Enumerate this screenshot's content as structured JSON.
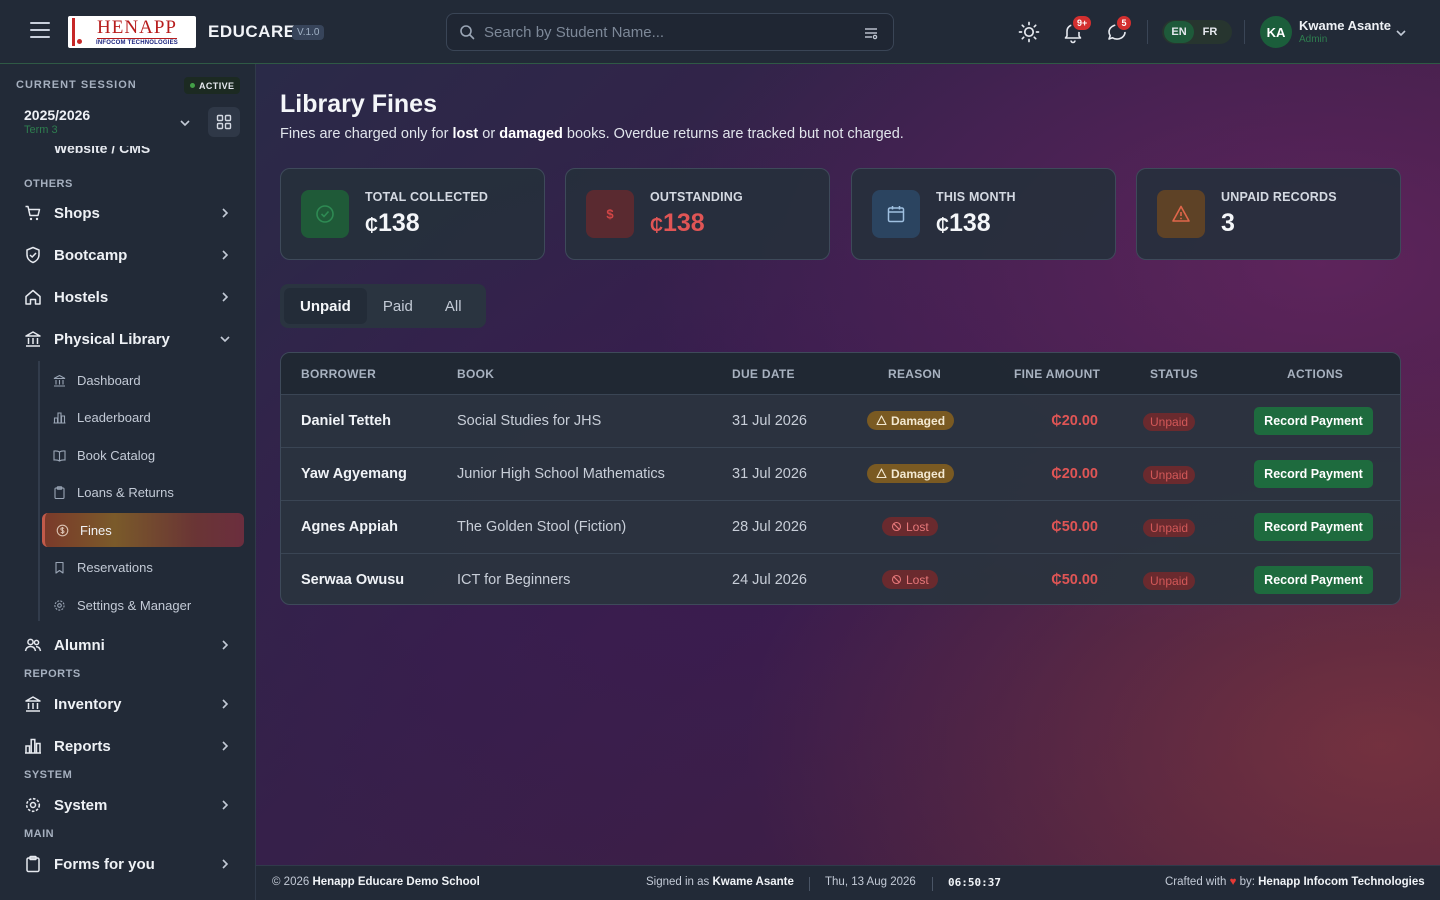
{
  "header": {
    "logo_big": "HENAPP",
    "logo_small": "INFOCOM TECHNOLOGIES",
    "brand": "EDUCARE",
    "version": "V.1.0",
    "search_placeholder": "Search by Student Name...",
    "notifications_badge": "9+",
    "messages_badge": "5",
    "lang_en": "EN",
    "lang_fr": "FR",
    "user_initials": "KA",
    "user_name": "Kwame Asante",
    "user_role": "Admin"
  },
  "sidebar": {
    "session_label": "CURRENT SESSION",
    "session_status": "ACTIVE",
    "session_year": "2025/2026",
    "session_term": "Term 3",
    "partial_item": "Website / CMS",
    "sections": {
      "others": "OTHERS",
      "reports": "REPORTS",
      "system": "SYSTEM",
      "main": "MAIN"
    },
    "items": {
      "shops": "Shops",
      "bootcamp": "Bootcamp",
      "hostels": "Hostels",
      "physical_library": "Physical Library",
      "alumni": "Alumni",
      "inventory": "Inventory",
      "reports": "Reports",
      "system": "System",
      "forms": "Forms for you"
    },
    "library_sub": {
      "dashboard": "Dashboard",
      "leaderboard": "Leaderboard",
      "catalog": "Book Catalog",
      "loans": "Loans & Returns",
      "fines": "Fines",
      "reservations": "Reservations",
      "settings": "Settings & Manager"
    }
  },
  "main": {
    "title": "Library Fines",
    "subtitle_pre": "Fines are charged only for ",
    "subtitle_b1": "lost",
    "subtitle_mid": " or ",
    "subtitle_b2": "damaged",
    "subtitle_post": " books. Overdue returns are tracked but not charged.",
    "cards": [
      {
        "label": "TOTAL COLLECTED",
        "currency": "₵",
        "value": "138"
      },
      {
        "label": "OUTSTANDING",
        "currency": "₵",
        "value": "138"
      },
      {
        "label": "THIS MONTH",
        "currency": "₵",
        "value": "138"
      },
      {
        "label": "UNPAID RECORDS",
        "value": "3"
      }
    ],
    "tabs": [
      "Unpaid",
      "Paid",
      "All"
    ],
    "table": {
      "headers": [
        "BORROWER",
        "BOOK",
        "DUE DATE",
        "REASON",
        "FINE AMOUNT",
        "STATUS",
        "ACTIONS"
      ],
      "rows": [
        {
          "borrower": "Daniel Tetteh",
          "book": "Social Studies for JHS",
          "due": "31 Jul 2026",
          "reason": "Damaged",
          "amount": "₵20.00",
          "status": "Unpaid",
          "action": "Record Payment"
        },
        {
          "borrower": "Yaw Agyemang",
          "book": "Junior High School Mathematics",
          "due": "31 Jul 2026",
          "reason": "Damaged",
          "amount": "₵20.00",
          "status": "Unpaid",
          "action": "Record Payment"
        },
        {
          "borrower": "Agnes Appiah",
          "book": "The Golden Stool (Fiction)",
          "due": "28 Jul 2026",
          "reason": "Lost",
          "amount": "₵50.00",
          "status": "Unpaid",
          "action": "Record Payment"
        },
        {
          "borrower": "Serwaa Owusu",
          "book": "ICT for Beginners",
          "due": "24 Jul 2026",
          "reason": "Lost",
          "amount": "₵50.00",
          "status": "Unpaid",
          "action": "Record Payment"
        }
      ]
    }
  },
  "footer": {
    "copyright_pre": "© 2026 ",
    "school": "Henapp Educare Demo School",
    "signed_pre": "Signed in as ",
    "signed_user": "Kwame Asante",
    "date": "Thu, 13 Aug 2026",
    "time": "06:50:37",
    "crafted_pre": "Crafted with",
    "heart": "♥",
    "crafted_by": " by: ",
    "company": "Henapp Infocom Technologies"
  },
  "colors": {
    "accent_green": "#1e6b3e",
    "danger_red": "#e05555",
    "warning_amber": "#7a5a22"
  }
}
